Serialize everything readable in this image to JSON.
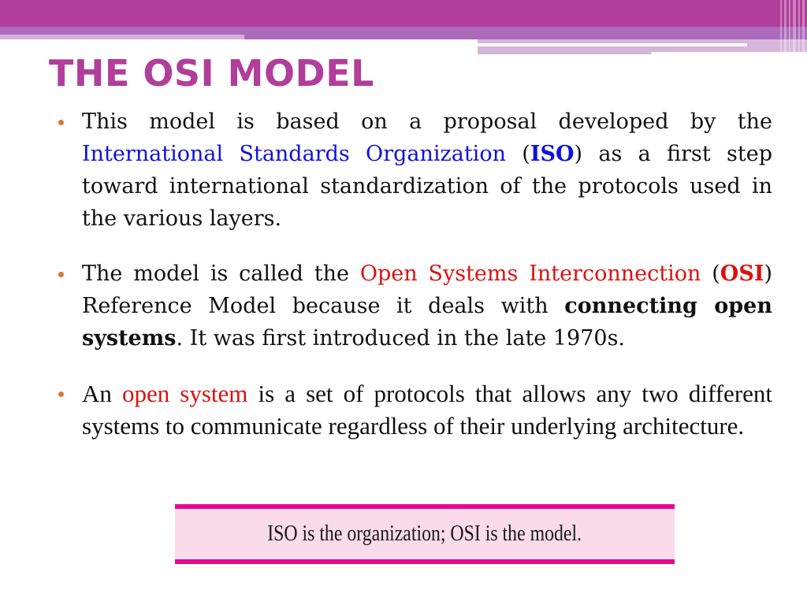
{
  "slide": {
    "title": "THE OSI MODEL",
    "colors": {
      "header_band": "#b03e9a",
      "header_band_light": "#ac6aba",
      "title": "#b03e9a",
      "bullet_dot": "#d9753a",
      "highlight_blue": "#1010e0",
      "highlight_red": "#e01010",
      "callout_border": "#e8088c",
      "callout_fill": "#fadbea"
    },
    "bullets": [
      {
        "parts": {
          "p1": "This model is based on a proposal developed by the ",
          "p2": "International Standards Organization",
          "p3": " (",
          "p4": "ISO",
          "p5": ") as a first step toward international standardization of the protocols used in the various layers."
        }
      },
      {
        "parts": {
          "p1": "The model is called the ",
          "p2": "Open Systems Interconnection",
          "p3": " (",
          "p4": "OSI",
          "p5": ") Reference Model because it deals with ",
          "p6": "connecting open systems",
          "p7": ". It was first introduced in the late 1970s."
        }
      },
      {
        "parts": {
          "p1": "An ",
          "p2": "open system",
          "p3": " is a set of protocols that allows any two different systems to communicate regardless of their underlying architecture."
        }
      }
    ],
    "callout": "ISO is the organization; OSI is the model."
  }
}
